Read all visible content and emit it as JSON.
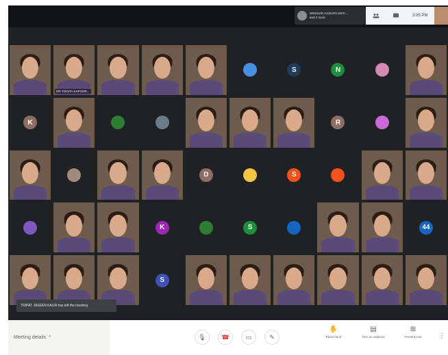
{
  "presenter": {
    "name": "SRIDHAR AASHITA MOTI...",
    "subtitle": "and 2 more"
  },
  "header": {
    "time": "3:05 PM"
  },
  "notification": {
    "text": "TRIPAT JASEEN KAUR has left the meeting"
  },
  "bottom_bar": {
    "meeting_details": "Meeting details",
    "meeting_details_chevron": "^",
    "raise_hand": "Raise hand",
    "captions": "Turn on captions",
    "present": "Present now",
    "more": "⋮"
  },
  "participants": [
    {
      "type": "video",
      "name": ""
    },
    {
      "type": "video",
      "name": "DR YOGITA KAPOOR..."
    },
    {
      "type": "video",
      "name": ""
    },
    {
      "type": "video",
      "name": ""
    },
    {
      "type": "video",
      "name": ""
    },
    {
      "type": "avatar",
      "letter": "",
      "color": "#4a90e2"
    },
    {
      "type": "avatar",
      "letter": "S",
      "color": "#203a5a"
    },
    {
      "type": "avatar",
      "letter": "N",
      "color": "#1e8e3e"
    },
    {
      "type": "avatar",
      "letter": "",
      "color": "#d48bb3"
    },
    {
      "type": "video",
      "name": ""
    },
    {
      "type": "avatar",
      "letter": "K",
      "color": "#8d6e63"
    },
    {
      "type": "video",
      "name": ""
    },
    {
      "type": "avatar",
      "letter": "",
      "color": "#2e7d32"
    },
    {
      "type": "avatar",
      "letter": "",
      "color": "#6d7c8b"
    },
    {
      "type": "video",
      "name": ""
    },
    {
      "type": "video",
      "name": ""
    },
    {
      "type": "video",
      "name": ""
    },
    {
      "type": "avatar",
      "letter": "R",
      "color": "#8d6e63"
    },
    {
      "type": "avatar",
      "letter": "",
      "color": "#c96bd6"
    },
    {
      "type": "video",
      "name": ""
    },
    {
      "type": "video",
      "name": ""
    },
    {
      "type": "avatar",
      "letter": "",
      "color": "#a1887f"
    },
    {
      "type": "video",
      "name": ""
    },
    {
      "type": "video",
      "name": ""
    },
    {
      "type": "avatar",
      "letter": "D",
      "color": "#8d6e63"
    },
    {
      "type": "avatar",
      "letter": "",
      "color": "#f4c542"
    },
    {
      "type": "avatar",
      "letter": "S",
      "color": "#f4511e"
    },
    {
      "type": "avatar",
      "letter": "",
      "color": "#f4511e"
    },
    {
      "type": "video",
      "name": ""
    },
    {
      "type": "video",
      "name": ""
    },
    {
      "type": "avatar",
      "letter": "",
      "color": "#7e57c2"
    },
    {
      "type": "video",
      "name": ""
    },
    {
      "type": "video",
      "name": ""
    },
    {
      "type": "avatar",
      "letter": "K",
      "color": "#9c27b0"
    },
    {
      "type": "avatar",
      "letter": "",
      "color": "#2e7d32"
    },
    {
      "type": "avatar",
      "letter": "S",
      "color": "#1e8e3e"
    },
    {
      "type": "avatar",
      "letter": "",
      "color": "#1565c0"
    },
    {
      "type": "video",
      "name": ""
    },
    {
      "type": "video",
      "name": ""
    },
    {
      "type": "avatar",
      "letter": "44",
      "color": "#1565c0"
    },
    {
      "type": "video",
      "name": ""
    },
    {
      "type": "video",
      "name": ""
    },
    {
      "type": "video",
      "name": ""
    },
    {
      "type": "avatar",
      "letter": "S",
      "color": "#3f51b5"
    },
    {
      "type": "video",
      "name": ""
    },
    {
      "type": "video",
      "name": ""
    },
    {
      "type": "video",
      "name": ""
    },
    {
      "type": "video",
      "name": ""
    },
    {
      "type": "video",
      "name": ""
    },
    {
      "type": "video",
      "name": ""
    }
  ]
}
